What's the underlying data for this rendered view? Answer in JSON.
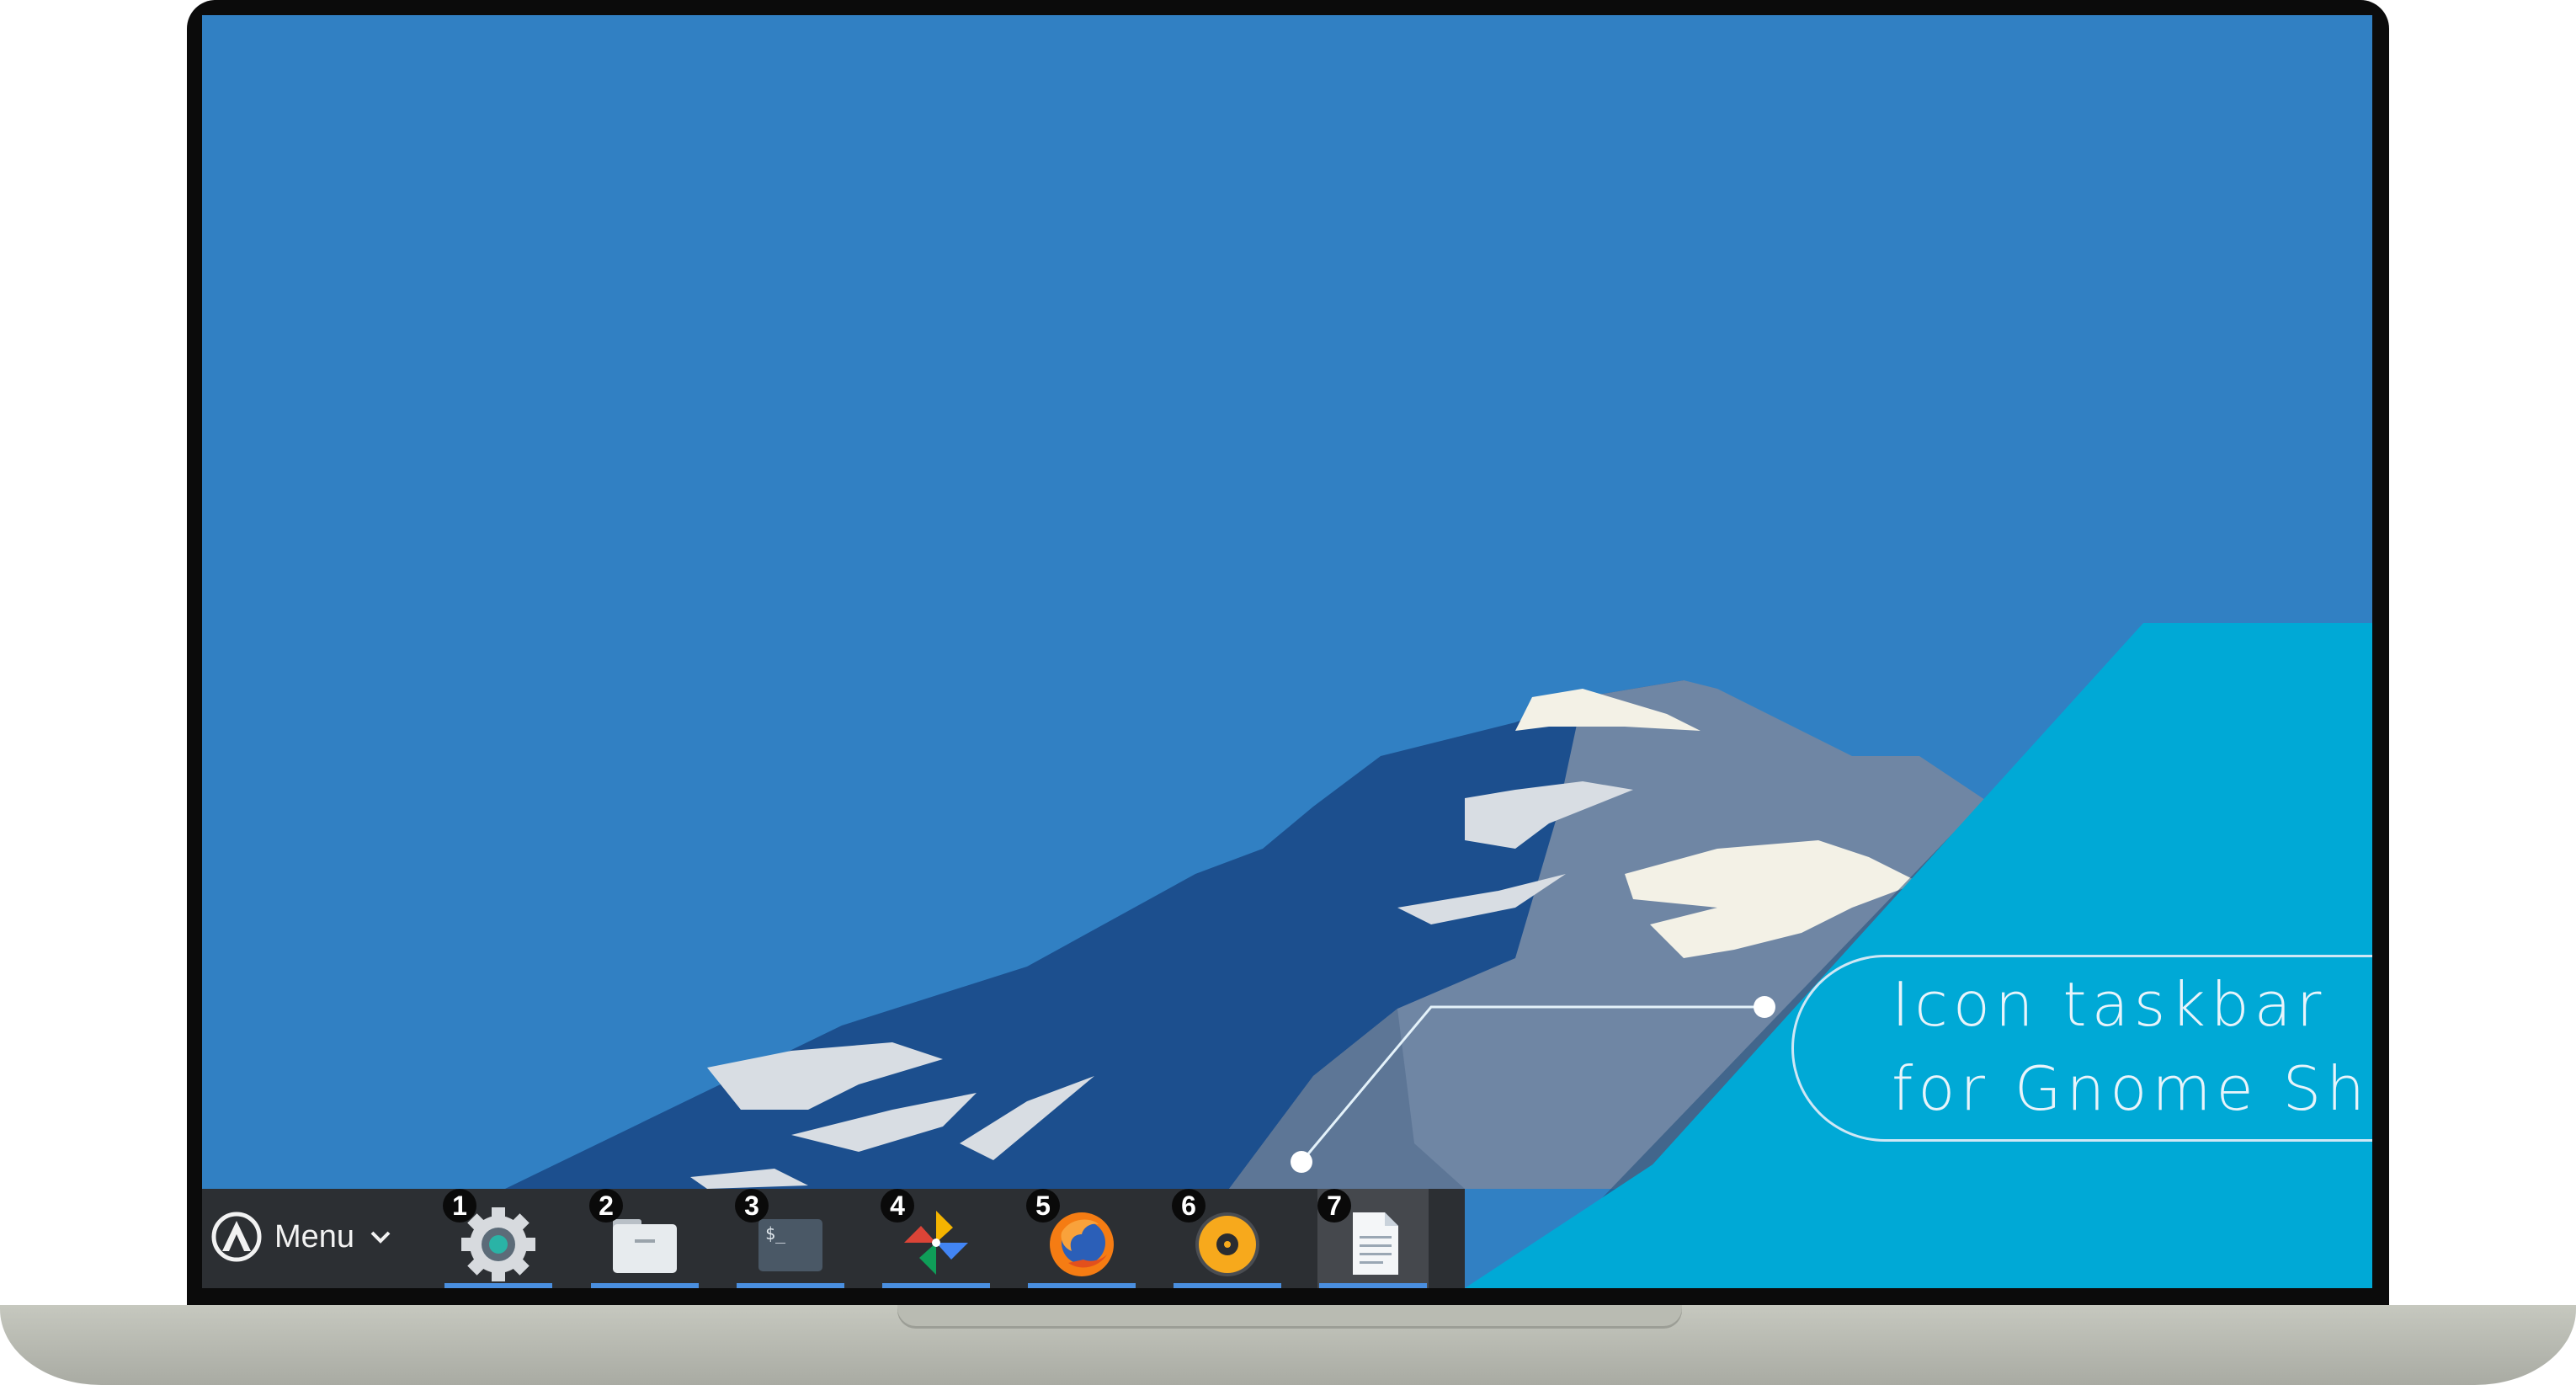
{
  "taskbar": {
    "menu_label": "Menu",
    "apps": [
      {
        "number": "1",
        "icon": "settings-gear-icon"
      },
      {
        "number": "2",
        "icon": "folder-icon"
      },
      {
        "number": "3",
        "icon": "terminal-icon"
      },
      {
        "number": "4",
        "icon": "photos-pinwheel-icon"
      },
      {
        "number": "5",
        "icon": "firefox-icon"
      },
      {
        "number": "6",
        "icon": "music-player-icon"
      },
      {
        "number": "7",
        "icon": "text-document-icon"
      }
    ]
  },
  "callout": {
    "line1": "Icon taskbar",
    "line2": "for Gnome Shell"
  },
  "colors": {
    "sky": "#3180c3",
    "panel": "#00a9d6",
    "taskbar": "#2c2f33",
    "indicator": "#4a8fe0"
  }
}
